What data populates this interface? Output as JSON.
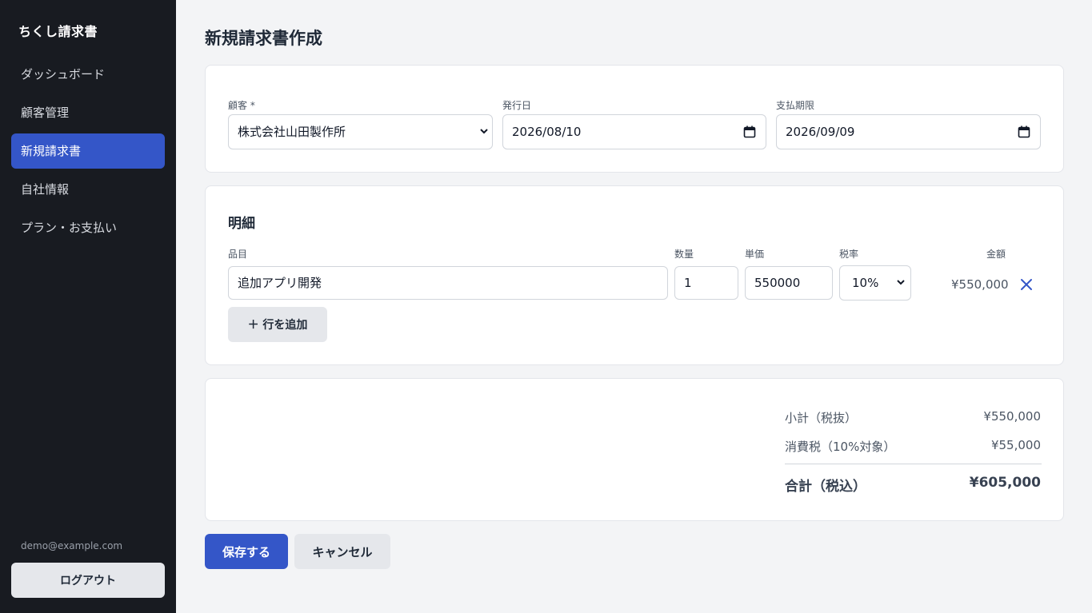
{
  "app": {
    "brand": "ちくし請求書"
  },
  "sidebar": {
    "items": [
      {
        "label": "ダッシュボード",
        "active": false
      },
      {
        "label": "顧客管理",
        "active": false
      },
      {
        "label": "新規請求書",
        "active": true
      },
      {
        "label": "自社情報",
        "active": false
      },
      {
        "label": "プラン・お支払い",
        "active": false
      }
    ],
    "user_email": "demo@example.com",
    "logout_label": "ログアウト"
  },
  "page": {
    "title": "新規請求書作成"
  },
  "form": {
    "customer_label": "顧客 *",
    "customer_value": "株式会社山田製作所",
    "issue_date_label": "発行日",
    "issue_date_value": "2026/08/10",
    "due_date_label": "支払期限",
    "due_date_value": "2026/09/09"
  },
  "details": {
    "title": "明細",
    "columns": {
      "item": "品目",
      "quantity": "数量",
      "unit_price": "単価",
      "tax_rate": "税率",
      "amount": "金額"
    },
    "rows": [
      {
        "item": "追加アプリ開発",
        "quantity": "1",
        "unit_price": "550000",
        "tax_rate": "10%",
        "amount": "¥550,000"
      }
    ],
    "add_row_label": "＋ 行を追加"
  },
  "summary": {
    "subtotal_label": "小計（税抜）",
    "subtotal_value": "¥550,000",
    "tax_label": "消費税（10%対象）",
    "tax_value": "¥55,000",
    "total_label": "合計（税込）",
    "total_value": "¥605,000"
  },
  "actions": {
    "save_label": "保存する",
    "cancel_label": "キャンセル"
  },
  "colors": {
    "accent": "#3456c8",
    "sidebar_bg": "#181b21",
    "page_bg": "#f3f4f6"
  },
  "icons": {
    "select_caret": "chevron-down-icon",
    "date_picker": "calendar-icon",
    "remove_row": "close-icon"
  }
}
